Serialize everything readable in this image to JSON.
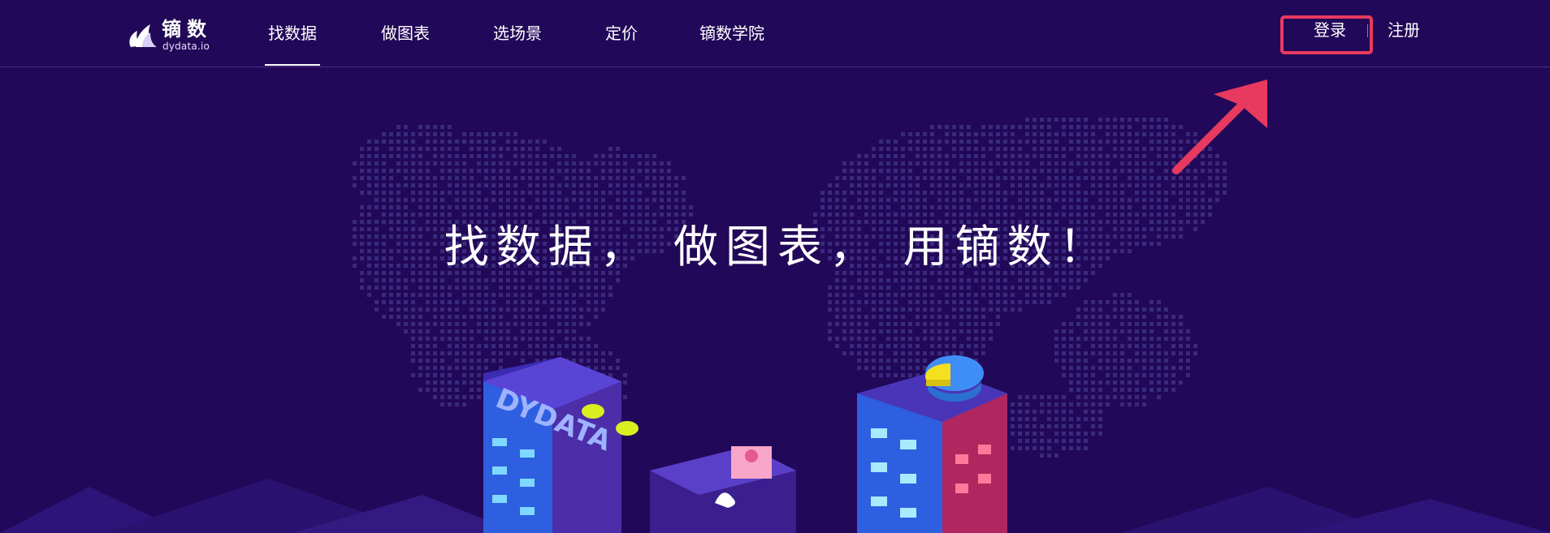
{
  "logo": {
    "name": "镝数",
    "domain": "dydata.io"
  },
  "nav": {
    "items": [
      {
        "label": "找数据",
        "active": true
      },
      {
        "label": "做图表",
        "active": false
      },
      {
        "label": "选场景",
        "active": false
      },
      {
        "label": "定价",
        "active": false
      },
      {
        "label": "镝数学院",
        "active": false
      }
    ]
  },
  "auth": {
    "login_label": "登录",
    "register_label": "注册"
  },
  "hero": {
    "headline": "找数据， 做图表， 用镝数！",
    "building_text": "DYDATA"
  },
  "colors": {
    "background": "#220858",
    "annotation": "#e83a5f",
    "map_dots": "#3a2a7c"
  },
  "icons": {
    "logo_mark": "leaf-drop-icon",
    "annotation_arrow": "arrow-up-right-icon"
  }
}
